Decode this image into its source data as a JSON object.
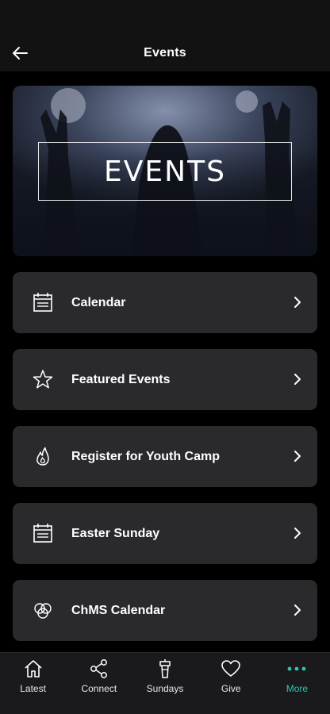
{
  "header": {
    "title": "Events",
    "back_icon": "arrow-left-icon"
  },
  "banner": {
    "text": "EVENTS"
  },
  "menu": {
    "items": [
      {
        "label": "Calendar",
        "icon": "calendar-icon"
      },
      {
        "label": "Featured Events",
        "icon": "star-icon"
      },
      {
        "label": "Register for Youth Camp",
        "icon": "flame-icon"
      },
      {
        "label": "Easter Sunday",
        "icon": "calendar-icon"
      },
      {
        "label": "ChMS Calendar",
        "icon": "circles-icon"
      }
    ]
  },
  "tabbar": {
    "accent_color": "#2ec4b6",
    "tabs": [
      {
        "label": "Latest",
        "icon": "home-icon"
      },
      {
        "label": "Connect",
        "icon": "share-icon"
      },
      {
        "label": "Sundays",
        "icon": "podium-icon"
      },
      {
        "label": "Give",
        "icon": "heart-icon"
      },
      {
        "label": "More",
        "icon": "more-dots-icon",
        "active": true
      }
    ]
  }
}
